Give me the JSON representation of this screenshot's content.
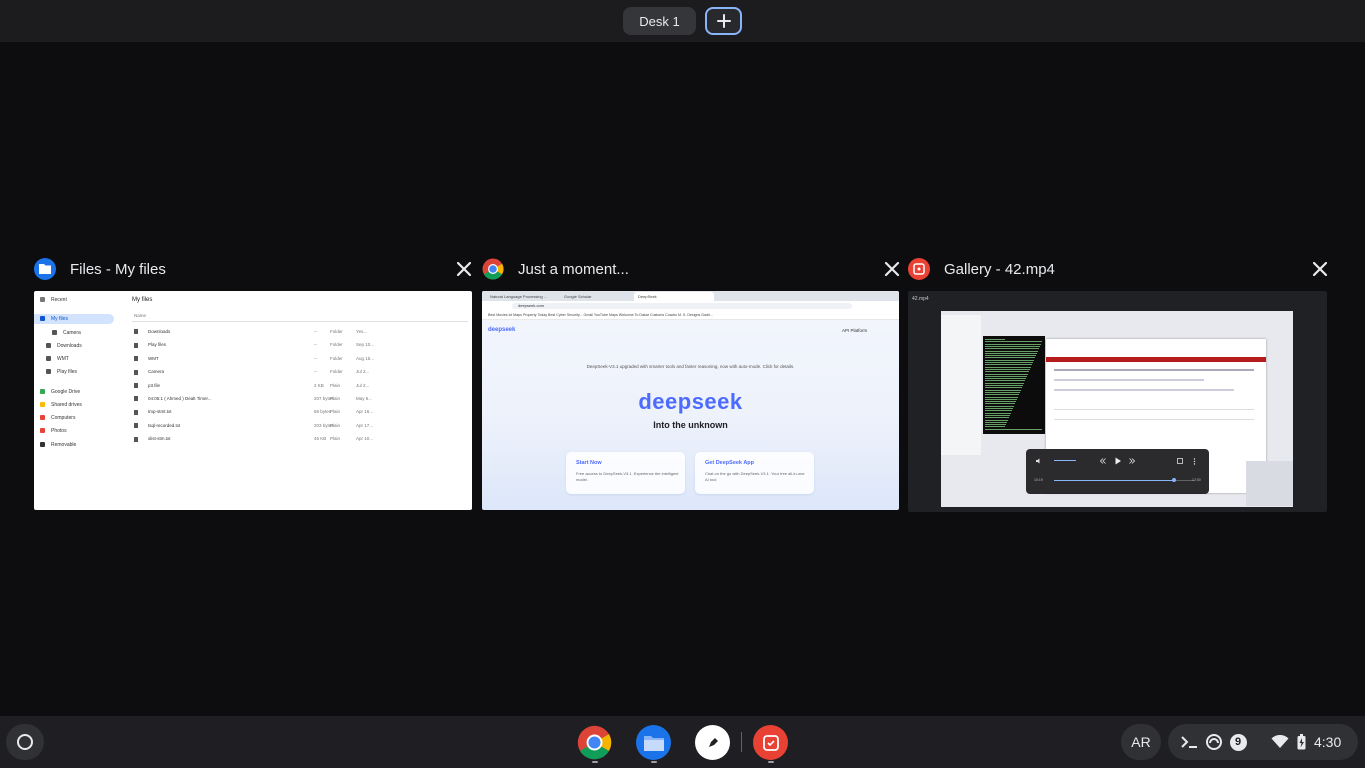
{
  "desks": {
    "desk_label": "Desk 1",
    "add_icon": "plus-icon"
  },
  "windows": [
    {
      "title": "Files - My files",
      "app_icon": "files-app-icon",
      "close_icon": "close-icon",
      "preview": {
        "sidebar": [
          "Recent",
          "My files",
          "Camera",
          "Downloads",
          "Play files",
          "Google Drive",
          "Shared drives",
          "Computers",
          "Photos",
          "Removable"
        ],
        "main_title": "My files",
        "column_header": "Name",
        "rows": [
          {
            "name": "Downloads",
            "size": "--",
            "type": "Folder",
            "date": "Yes..."
          },
          {
            "name": "Play files",
            "size": "--",
            "type": "Folder",
            "date": "Sep 10..."
          },
          {
            "name": "WMT",
            "size": "--",
            "type": "Folder",
            "date": "Aug 15..."
          },
          {
            "name": "Camera",
            "size": "--",
            "type": "Folder",
            "date": "Jul 2..."
          },
          {
            "name": "p3.file",
            "size": "2 KB",
            "type": "Plain",
            "date": "Jul 2..."
          },
          {
            "name": "04:05:1 ( Ahmed ) Dealt Timer...",
            "size": "207 bytes",
            "type": "Plain",
            "date": "May 5..."
          },
          {
            "name": "tmp-stmt.txt",
            "size": "56 bytes",
            "type": "Plain",
            "date": "Apr 16..."
          },
          {
            "name": "tsql-recorded.txt",
            "size": "203 bytes",
            "type": "Plain",
            "date": "Apr 17..."
          },
          {
            "name": "xlist-stm.txt",
            "size": "45 KB",
            "type": "Plain",
            "date": "Apr 10..."
          }
        ]
      }
    },
    {
      "title": "Just a moment...",
      "app_icon": "chrome-app-icon",
      "close_icon": "close-icon",
      "preview": {
        "tabs": [
          "Natural Language Processing ...",
          "Google Scholar",
          "DeepSeek"
        ],
        "url": "deepseek.com",
        "bookmarks": "Best Movies   ict   Maps   Property Today   Best Cyber Security...   Gmail   YouTube   Maps   Welcome To Dakar   Customs Cuadro   M. S. Designs Gadir...",
        "site_logo": "deepseek",
        "api_link": "API Platform",
        "notice": "DeepSeek-V3.1 upgraded with smarter tools and faster reasoning, now with auto-mode. Click for details.",
        "brand": "deepseek",
        "tagline": "Into the unknown",
        "cards": [
          {
            "heading": "Start Now",
            "sub": "Free access to DeepSeek-V3.1. Experience the intelligent model."
          },
          {
            "heading": "Get DeepSeek App",
            "sub": "Chat on the go with DeepSeek-V3.1. Your free all-in-one AI tool"
          }
        ]
      }
    },
    {
      "title": "Gallery - 42.mp4",
      "app_icon": "gallery-app-icon",
      "close_icon": "close-icon",
      "preview": {
        "file_label": "42.mp4",
        "time_elapsed": "10:19",
        "time_total": "12:00",
        "progress": 0.86
      }
    }
  ],
  "shelf": {
    "launcher_icon": "launcher-icon",
    "apps": [
      "chrome",
      "files",
      "ink",
      "gallery"
    ],
    "ime": "AR",
    "clock": "4:30",
    "notification_count": "9",
    "tray_icons": [
      "terminal-icon",
      "sync-icon",
      "notifications-badge",
      "wifi-icon",
      "battery-icon"
    ]
  }
}
